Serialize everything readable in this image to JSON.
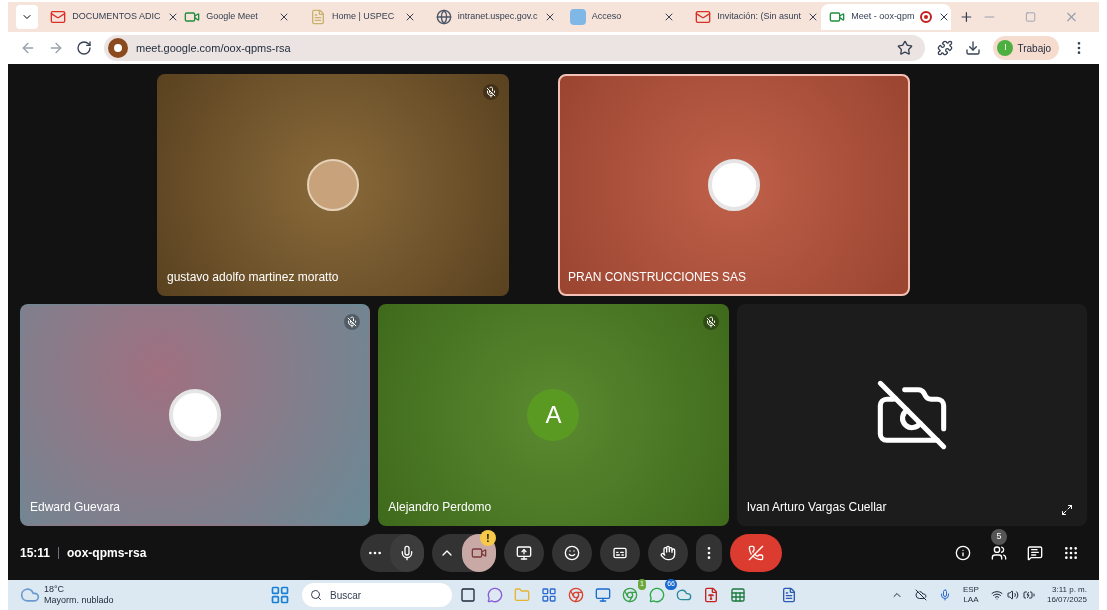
{
  "tabs": [
    {
      "title": "DOCUMENTOS ADIC",
      "kind": "mail",
      "selected": false,
      "recording": false
    },
    {
      "title": "Google Meet",
      "kind": "video",
      "selected": false,
      "recording": false
    },
    {
      "title": "Home | USPEC",
      "kind": "page",
      "selected": false,
      "recording": false
    },
    {
      "title": "intranet.uspec.gov.c",
      "kind": "globe",
      "selected": false,
      "recording": false
    },
    {
      "title": "Acceso",
      "kind": "logo",
      "selected": false,
      "recording": false
    },
    {
      "title": "Invitación: (Sin asunt",
      "kind": "mail",
      "selected": false,
      "recording": false
    },
    {
      "title": "Meet - oox-qpm",
      "kind": "video",
      "selected": true,
      "recording": true
    }
  ],
  "address": {
    "url": "meet.google.com/oox-qpms-rsa"
  },
  "profile": {
    "initial": "I",
    "label": "Trabajo"
  },
  "tiles_top": [
    {
      "name": "gustavo adolfo martinez moratto",
      "kind": "avatar",
      "muted": true,
      "speaking": false
    },
    {
      "name": "PRAN CONSTRUCCIONES SAS",
      "kind": "logo",
      "muted": false,
      "speaking": true
    }
  ],
  "tiles_bottom": [
    {
      "name": "Edward Guevara",
      "kind": "logo",
      "muted": true,
      "speaking": false
    },
    {
      "name": "Alejandro Perdomo",
      "kind": "letter",
      "letter": "A",
      "muted": true,
      "speaking": false
    },
    {
      "name": "Ivan Arturo Vargas Cuellar",
      "kind": "camera-off",
      "muted": false,
      "speaking": false
    }
  ],
  "meeting": {
    "time": "15:11",
    "code": "oox-qpms-rsa"
  },
  "controls": {
    "camera_warning": "!",
    "people_count": "5"
  },
  "taskbar": {
    "temperature": "18°C",
    "weather": "Mayorm. nublado",
    "search": "Buscar",
    "chrome_badge": "1",
    "whatsapp_badge": "66",
    "language": "ESP",
    "layout": "LAA",
    "time": "3:11 p. m.",
    "date": "16/07/2025"
  }
}
